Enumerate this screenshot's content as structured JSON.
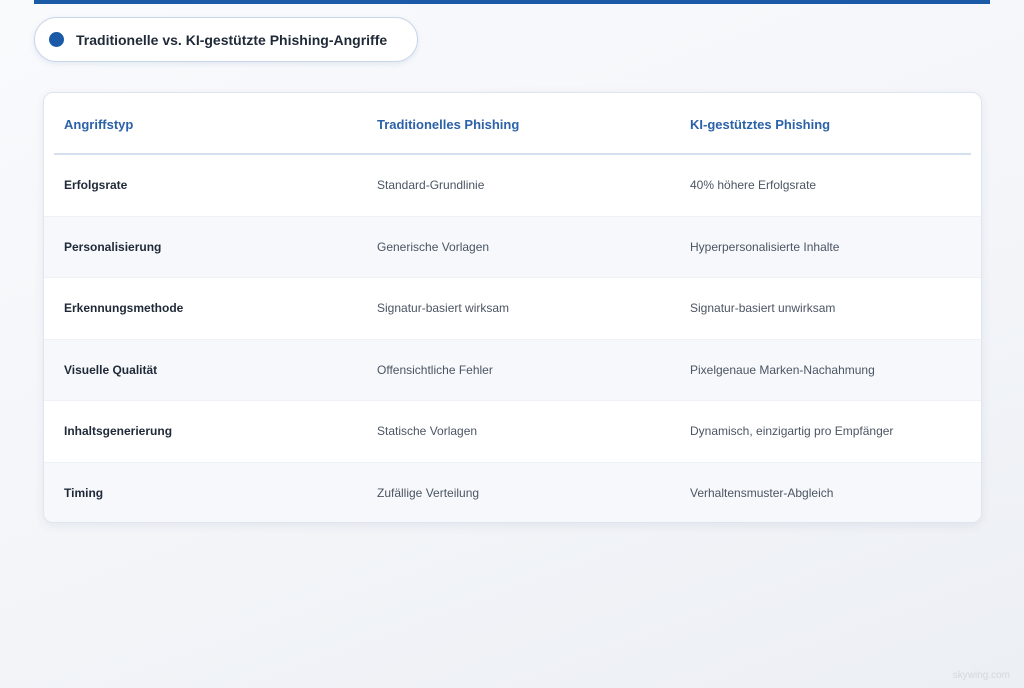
{
  "title": "Traditionelle vs. KI-gestützte Phishing-Angriffe",
  "colors": {
    "accent": "#1a5aa6",
    "header_text": "#2b62a8",
    "row_alt": "#f6f8fb"
  },
  "table": {
    "headers": [
      "Angriffstyp",
      "Traditionelles Phishing",
      "KI-gestütztes Phishing"
    ],
    "rows": [
      [
        "Erfolgsrate",
        "Standard-Grundlinie",
        "40% höhere Erfolgsrate"
      ],
      [
        "Personalisierung",
        "Generische Vorlagen",
        "Hyperpersonalisierte Inhalte"
      ],
      [
        "Erkennungsmethode",
        "Signatur-basiert wirksam",
        "Signatur-basiert unwirksam"
      ],
      [
        "Visuelle Qualität",
        "Offensichtliche Fehler",
        "Pixelgenaue Marken-Nachahmung"
      ],
      [
        "Inhaltsgenerierung",
        "Statische Vorlagen",
        "Dynamisch, einzigartig pro Empfänger"
      ],
      [
        "Timing",
        "Zufällige Verteilung",
        "Verhaltensmuster-Abgleich"
      ]
    ]
  },
  "watermark": "skywing.com"
}
